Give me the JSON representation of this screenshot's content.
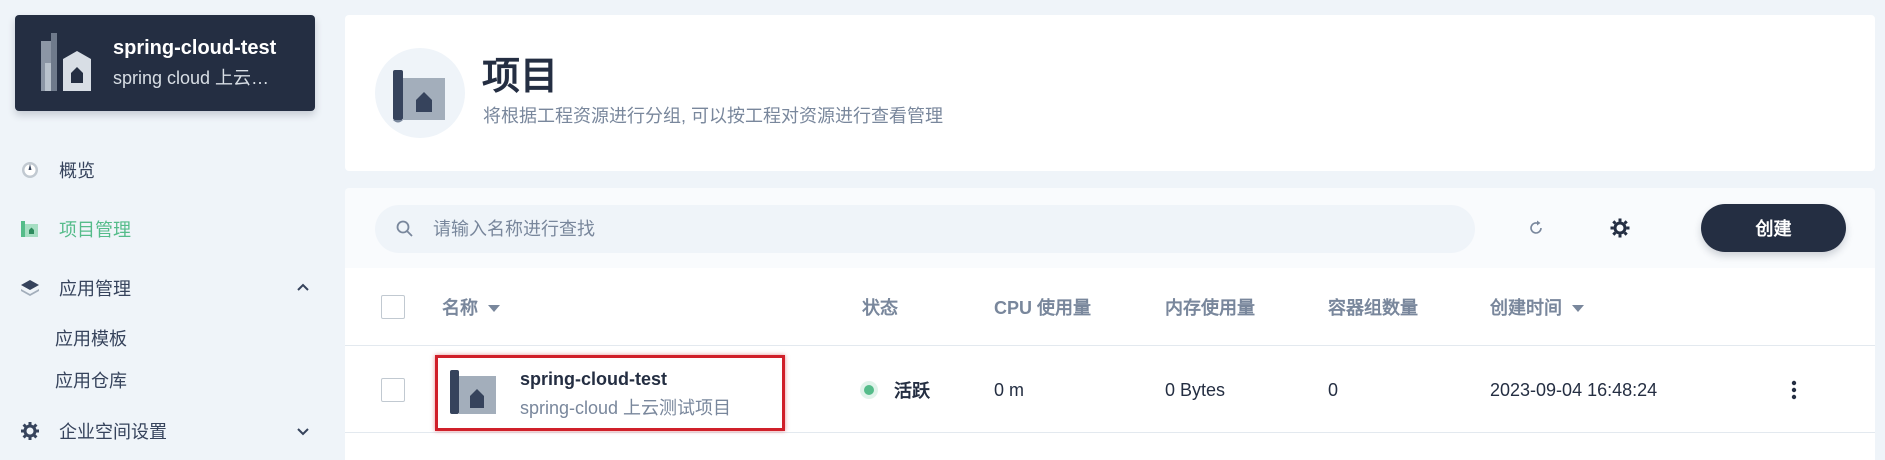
{
  "workspace": {
    "title": "spring-cloud-test",
    "description": "spring cloud 上云…"
  },
  "sidebar": {
    "items": [
      {
        "label": "概览",
        "icon": "dashboard-icon"
      },
      {
        "label": "项目管理",
        "icon": "project-icon",
        "active": true
      },
      {
        "label": "应用管理",
        "icon": "layers-icon",
        "expanded": true,
        "children": [
          {
            "label": "应用模板"
          },
          {
            "label": "应用仓库"
          }
        ]
      },
      {
        "label": "企业空间设置",
        "icon": "gear-icon",
        "expanded": false
      }
    ]
  },
  "header": {
    "title": "项目",
    "description": "将根据工程资源进行分组, 可以按工程对资源进行查看管理"
  },
  "toolbar": {
    "search_placeholder": "请输入名称进行查找",
    "create_label": "创建"
  },
  "table": {
    "columns": [
      "名称",
      "状态",
      "CPU 使用量",
      "内存使用量",
      "容器组数量",
      "创建时间"
    ],
    "rows": [
      {
        "name": "spring-cloud-test",
        "description": "spring-cloud 上云测试项目",
        "status": "活跃",
        "cpu": "0 m",
        "memory": "0 Bytes",
        "pods": "0",
        "created": "2023-09-04 16:48:24"
      }
    ]
  },
  "colors": {
    "accent": "#55bc8a",
    "dark": "#242e42",
    "highlight": "#d0202a"
  }
}
